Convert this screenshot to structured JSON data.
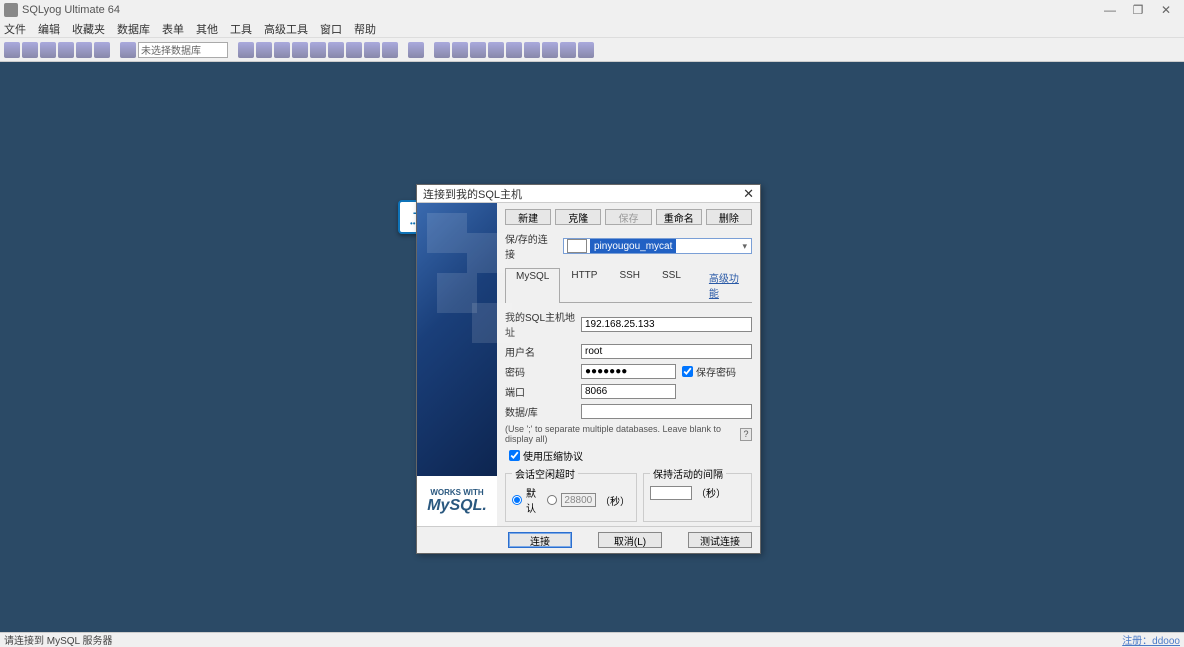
{
  "app": {
    "title": "SQLyog Ultimate 64"
  },
  "window_buttons": {
    "min": "—",
    "max": "❐",
    "close": "✕"
  },
  "menu": [
    "文件",
    "编辑",
    "收藏夹",
    "数据库",
    "表单",
    "其他",
    "工具",
    "高级工具",
    "窗口",
    "帮助"
  ],
  "toolbar": {
    "combo_placeholder": "未选择数据库"
  },
  "status": {
    "left": "请连接到 MySQL 服务器",
    "right": "注册：ddooo"
  },
  "dialog": {
    "title": "连接到我的SQL主机",
    "buttons_top": {
      "new": "新建",
      "clone": "克隆",
      "save": "保存",
      "rename": "重命名",
      "delete": "删除"
    },
    "saved_label": "保/存的连接",
    "saved_value": "pinyougou_mycat",
    "tabs": {
      "mysql": "MySQL",
      "http": "HTTP",
      "ssh": "SSH",
      "ssl": "SSL",
      "advanced": "高级功能"
    },
    "fields": {
      "host_label": "我的SQL主机地址",
      "host_value": "192.168.25.133",
      "user_label": "用户名",
      "user_value": "root",
      "pass_label": "密码",
      "pass_value": "●●●●●●●",
      "save_pass": "保存密码",
      "port_label": "端口",
      "port_value": "8066",
      "db_label": "数据/库",
      "db_value": ""
    },
    "hint": "(Use ';' to separate multiple databases. Leave blank to display all)",
    "hint_q": "?",
    "compress": "使用压缩协议",
    "timeout_legend": "会话空闲超时",
    "timeout_default": "默认",
    "timeout_value": "28800",
    "timeout_unit": "（秒）",
    "keepalive_legend": "保持活动的间隔",
    "keepalive_unit": "（秒）",
    "bottom": {
      "connect": "连接",
      "cancel": "取消(L)",
      "test": "测试连接"
    },
    "logo": {
      "works": "WORKS WITH",
      "mysql": "MySQL."
    }
  }
}
